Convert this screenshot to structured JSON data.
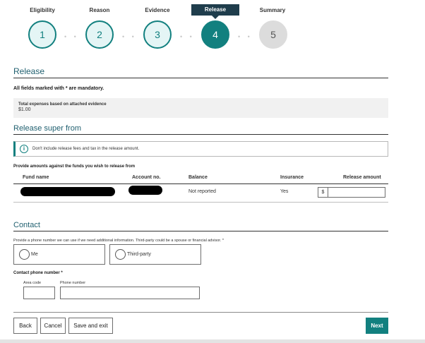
{
  "stepper": {
    "steps": [
      {
        "label": "Eligibility",
        "number": "1",
        "state": "done"
      },
      {
        "label": "Reason",
        "number": "2",
        "state": "done"
      },
      {
        "label": "Evidence",
        "number": "3",
        "state": "done"
      },
      {
        "label": "Release",
        "number": "4",
        "state": "active"
      },
      {
        "label": "Summary",
        "number": "5",
        "state": "todo"
      }
    ],
    "separator": "• •"
  },
  "release": {
    "title": "Release",
    "mandatory_note": "All fields marked with * are mandatory.",
    "expenses_label": "Total expenses based on attached evidence",
    "expenses_value": "$1.00"
  },
  "release_from": {
    "title": "Release super from",
    "info_icon": "i",
    "info_text": "Don't include release fees and tax in the release amount.",
    "provide_label": "Provide amounts against the funds you wish to release from",
    "columns": [
      "Fund name",
      "Account no.",
      "Balance",
      "Insurance",
      "Release amount"
    ],
    "rows": [
      {
        "balance": "Not reported",
        "insurance": "Yes",
        "currency": "$",
        "amount": ""
      }
    ]
  },
  "contact": {
    "title": "Contact",
    "help_text": "Provide a phone number we can use if we need additional information. Third-party could be a spouse or financial advisor. *",
    "options": [
      {
        "label": "Me"
      },
      {
        "label": "Third-party"
      }
    ],
    "phone_label": "Contact phone number *",
    "area_code_label": "Area code",
    "phone_number_label": "Phone number",
    "area_code_value": "",
    "phone_number_value": ""
  },
  "actions": {
    "back": "Back",
    "cancel": "Cancel",
    "save_exit": "Save and exit",
    "next": "Next"
  },
  "colors": {
    "accent": "#12807f",
    "heading": "#1f5f6f",
    "active_label_bg": "#1f3d4c"
  }
}
